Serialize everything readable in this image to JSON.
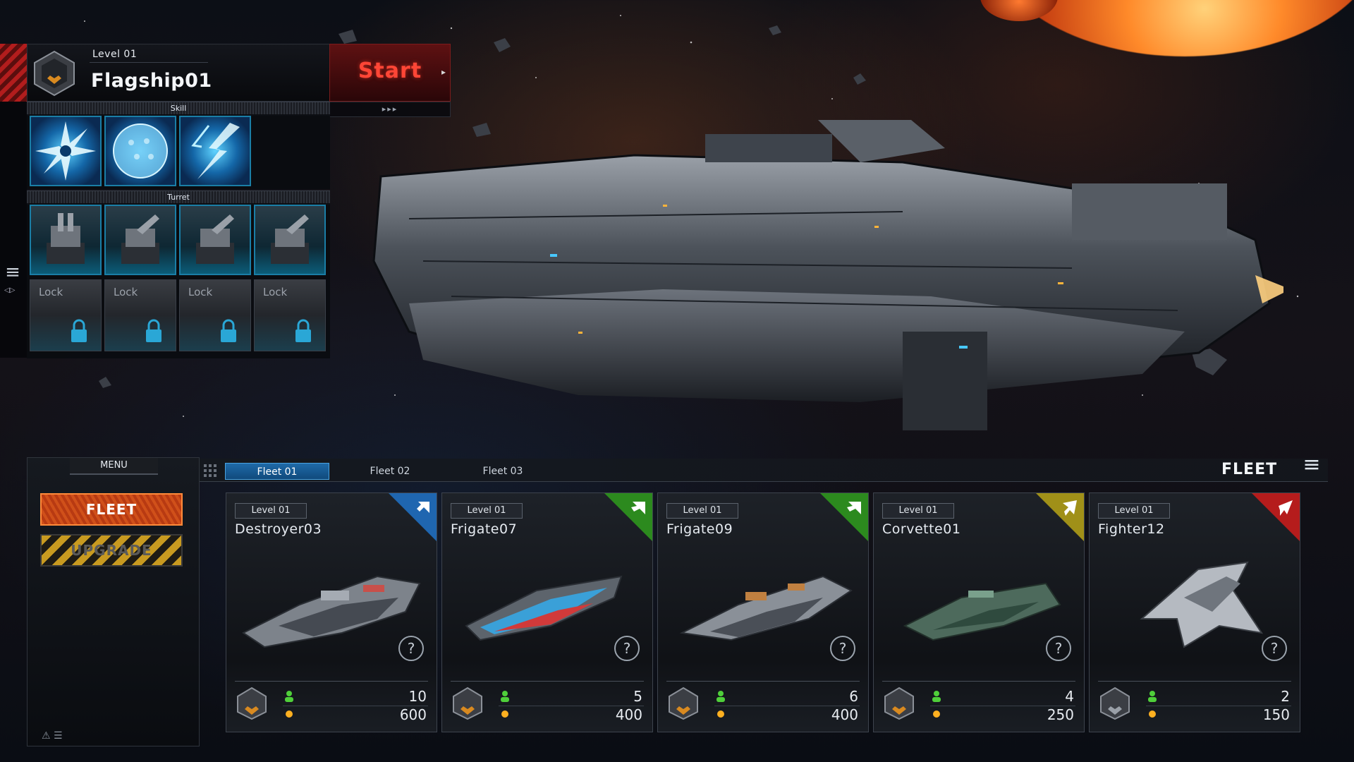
{
  "flagship": {
    "level": "Level 01",
    "name": "Flagship01",
    "start_label": "Start",
    "start_arrow": "▸",
    "start_sub": "▸▸▸",
    "skill_label": "Skill",
    "turret_label": "Turret",
    "lock_label": "Lock",
    "skills": [
      "shuriken-skill-icon",
      "shield-sphere-skill-icon",
      "lightning-skill-icon"
    ],
    "turrets": [
      "turret-1",
      "turret-2",
      "turret-3",
      "turret-4"
    ],
    "locked_count": 4
  },
  "menu": {
    "title": "MENU",
    "fleet_button": "FLEET",
    "upgrade_button": "UPGRADE"
  },
  "fleet": {
    "title": "FLEET",
    "tabs": [
      {
        "label": "Fleet 01",
        "active": true
      },
      {
        "label": "Fleet 02",
        "active": false
      },
      {
        "label": "Fleet 03",
        "active": false
      }
    ],
    "ships": [
      {
        "level": "Level 01",
        "name": "Destroyer03",
        "crew": "10",
        "cost": "600",
        "class_color": "#1f66b0",
        "class_icon": "destroyer-class-icon"
      },
      {
        "level": "Level 01",
        "name": "Frigate07",
        "crew": "5",
        "cost": "400",
        "class_color": "#2c8a1e",
        "class_icon": "frigate-class-icon"
      },
      {
        "level": "Level 01",
        "name": "Frigate09",
        "crew": "6",
        "cost": "400",
        "class_color": "#2c8a1e",
        "class_icon": "frigate-class-icon"
      },
      {
        "level": "Level 01",
        "name": "Corvette01",
        "crew": "4",
        "cost": "250",
        "class_color": "#a09018",
        "class_icon": "corvette-class-icon"
      },
      {
        "level": "Level 01",
        "name": "Fighter12",
        "crew": "2",
        "cost": "150",
        "class_color": "#b51c1c",
        "class_icon": "fighter-class-icon"
      }
    ],
    "help_label": "?"
  },
  "colors": {
    "accent_blue": "#1a7ea6",
    "start_red": "#ff4636",
    "fleet_orange": "#d0501a"
  }
}
